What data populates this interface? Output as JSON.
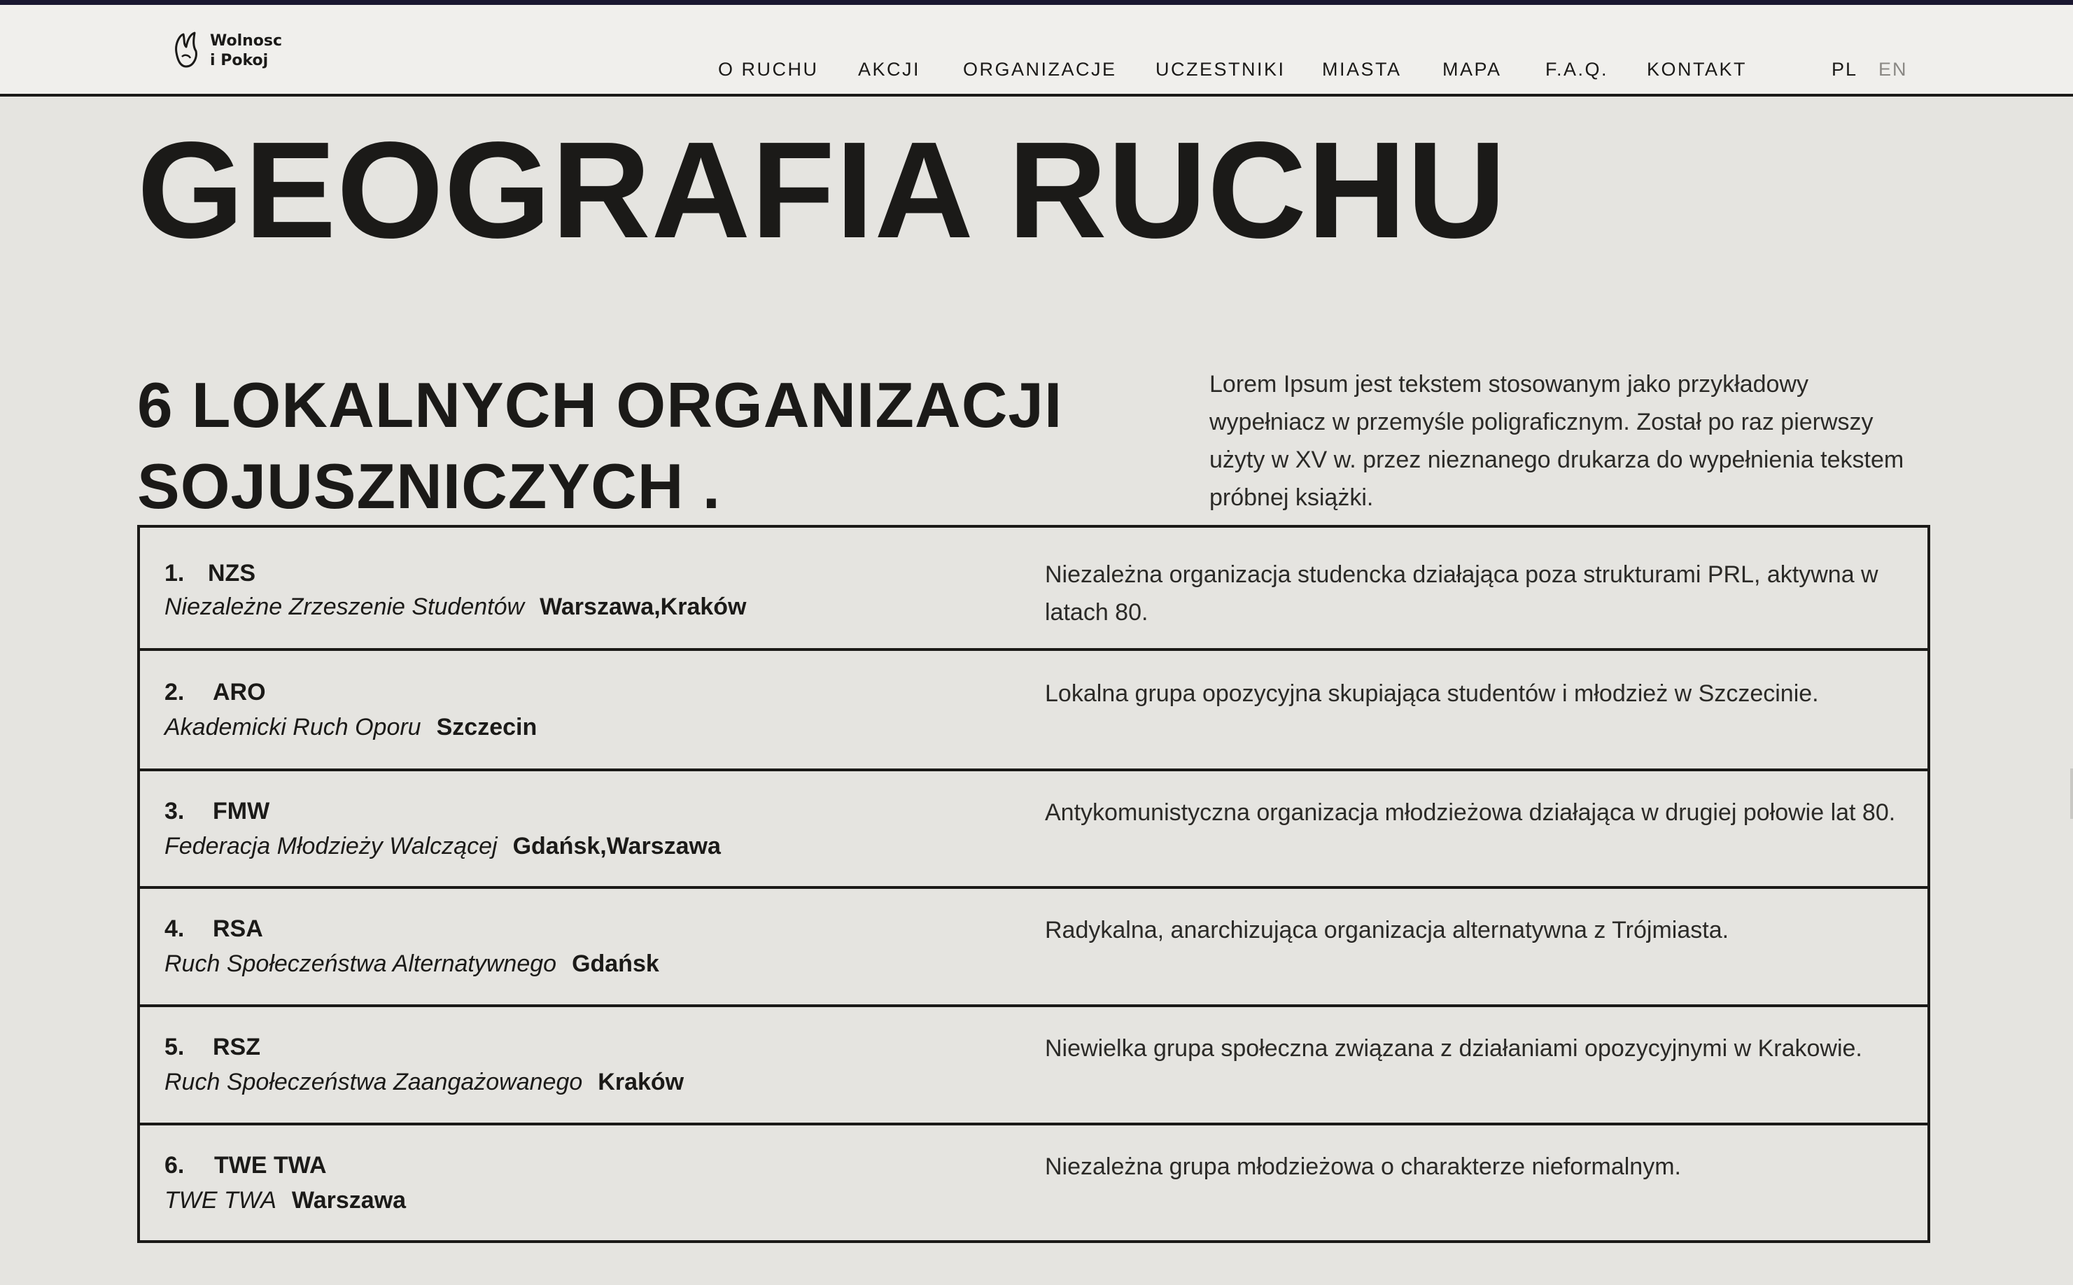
{
  "logo": {
    "line1": "Wolnosc",
    "line2": "i Pokoj",
    "icon": "hand-dove-icon"
  },
  "nav": {
    "items": [
      "O RUCHU",
      "AKCJI",
      "ORGANIZACJE",
      "UCZESTNIKI",
      "MIASTA",
      "MAPA",
      "F.A.Q.",
      "KONTAKT"
    ]
  },
  "languages": {
    "active": "PL",
    "inactive": "EN"
  },
  "page": {
    "title": "GEOGRAFIA RUCHU",
    "section_heading": "6 LOKALNYCH ORGANIZACJI SOJUSZNICZYCH .",
    "intro": "Lorem Ipsum jest tekstem stosowanym jako przykładowy wypełniacz w przemyśle poligraficznym. Został po raz pierwszy użyty w XV w. przez nieznanego drukarza do wypełnienia tekstem próbnej książki."
  },
  "organizations": [
    {
      "number": "1.",
      "abbr": "NZS",
      "full_name": "Niezależne Zrzeszenie Studentów",
      "cities": "Warszawa,Kraków",
      "description": "Niezależna organizacja studencka działająca poza strukturami PRL, aktywna w latach 80."
    },
    {
      "number": "2.",
      "abbr": "ARO",
      "full_name": "Akademicki Ruch Oporu",
      "cities": "Szczecin",
      "description": "Lokalna grupa opozycyjna skupiająca studentów i młodzież w Szczecinie."
    },
    {
      "number": "3.",
      "abbr": "FMW",
      "full_name": "Federacja Młodzieży Walczącej",
      "cities": "Gdańsk,Warszawa",
      "description": "Antykomunistyczna organizacja młodzieżowa działająca w drugiej połowie lat 80."
    },
    {
      "number": "4.",
      "abbr": "RSA",
      "full_name": "Ruch Społeczeństwa Alternatywnego",
      "cities": "Gdańsk",
      "description": "Radykalna, anarchizująca organizacja alternatywna z Trójmiasta."
    },
    {
      "number": "5.",
      "abbr": "RSZ",
      "full_name": "Ruch Społeczeństwa Zaangażowanego",
      "cities": "Kraków",
      "description": "Niewielka grupa społeczna związana z działaniami opozycyjnymi w Krakowie."
    },
    {
      "number": "6.",
      "abbr": "TWE TWA",
      "full_name": "TWE TWA",
      "cities": "Warszawa",
      "description": "Niezależna grupa młodzieżowa o charakterze nieformalnym."
    }
  ]
}
